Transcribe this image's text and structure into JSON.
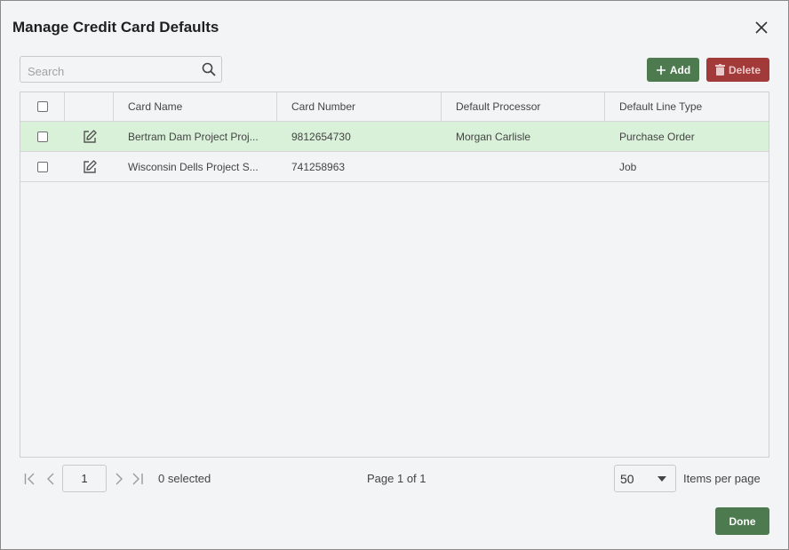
{
  "dialog": {
    "title": "Manage Credit Card Defaults",
    "close_icon": "close-icon"
  },
  "search": {
    "placeholder": "Search",
    "value": "",
    "icon": "search-icon"
  },
  "toolbar": {
    "add_label": "Add",
    "add_icon": "plus-icon",
    "delete_label": "Delete",
    "delete_icon": "trash-icon",
    "add_color": "#4d7a4f",
    "delete_color": "#a33a3a"
  },
  "table": {
    "columns": [
      "",
      "",
      "Card Name",
      "Card Number",
      "Default Processor",
      "Default Line Type"
    ],
    "rows": [
      {
        "card_name": "Bertram Dam Project Proj...",
        "card_number": "9812654730",
        "default_processor": "Morgan Carlisle",
        "default_line_type": "Purchase Order",
        "highlighted": true
      },
      {
        "card_name": "Wisconsin Dells Project S...",
        "card_number": "741258963",
        "default_processor": "",
        "default_line_type": "Job",
        "highlighted": false
      }
    ],
    "selected_row_color": "#d9f0d9"
  },
  "pager": {
    "page_input": "1",
    "selected_text": "0 selected",
    "page_text": "Page 1 of 1",
    "items_per_page_value": "50",
    "items_per_page_label": "Items per page"
  },
  "footer": {
    "done_label": "Done"
  }
}
